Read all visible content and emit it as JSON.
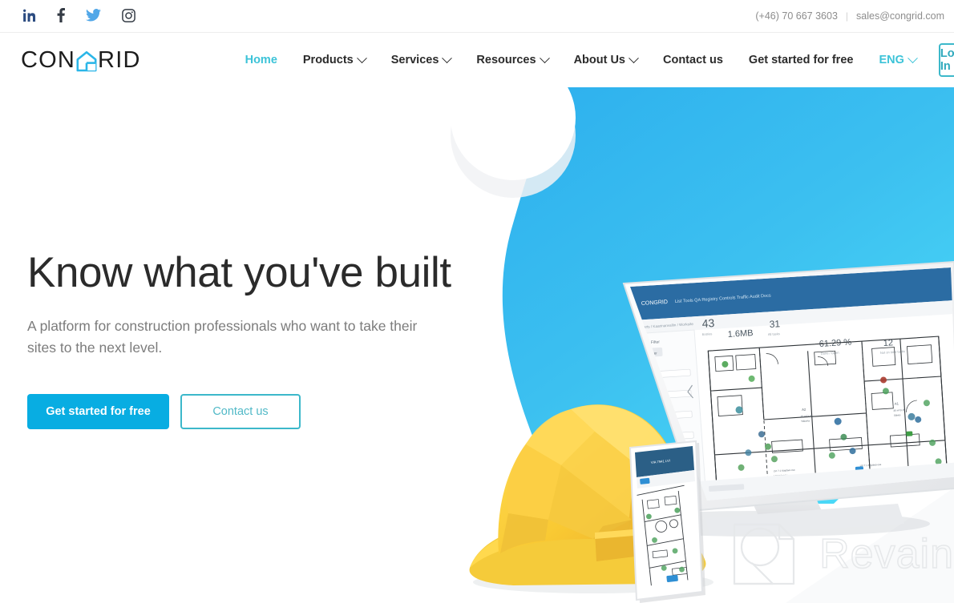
{
  "topbar": {
    "social": [
      {
        "name": "linkedin-icon",
        "label": "LinkedIn"
      },
      {
        "name": "facebook-icon",
        "label": "Facebook"
      },
      {
        "name": "twitter-icon",
        "label": "Twitter"
      },
      {
        "name": "instagram-icon",
        "label": "Instagram"
      }
    ],
    "phone": "(+46) 70 667 3603",
    "separator": "|",
    "email": "sales@congrid.com"
  },
  "brand": {
    "name_part1": "CON",
    "name_mark": "G",
    "name_part2": "RID",
    "mark_color": "#29b6e8"
  },
  "nav": {
    "items": [
      {
        "label": "Home",
        "has_dropdown": false,
        "active": true
      },
      {
        "label": "Products",
        "has_dropdown": true,
        "active": false
      },
      {
        "label": "Services",
        "has_dropdown": true,
        "active": false
      },
      {
        "label": "Resources",
        "has_dropdown": true,
        "active": false
      },
      {
        "label": "About Us",
        "has_dropdown": true,
        "active": false
      },
      {
        "label": "Contact us",
        "has_dropdown": false,
        "active": false
      },
      {
        "label": "Get started for free",
        "has_dropdown": false,
        "active": false
      }
    ],
    "language": {
      "label": "ENG",
      "has_dropdown": true
    },
    "login_label": "Log In"
  },
  "hero": {
    "title": "Know what you've built",
    "subtitle": "A platform for construction professionals who want to take their sites to the next level.",
    "primary_cta": "Get started for free",
    "secondary_cta": "Contact us",
    "background_color_top": "#34b4ec",
    "background_color_bottom": "#45d6f6",
    "app_screenshot": {
      "app_name": "CONGRID",
      "stats": [
        "43",
        "31",
        "61.29 %",
        "12"
      ],
      "room_labels": [
        "A2",
        "A1"
      ]
    }
  },
  "watermark": {
    "text": "Revain",
    "color": "#e6e8ea"
  }
}
